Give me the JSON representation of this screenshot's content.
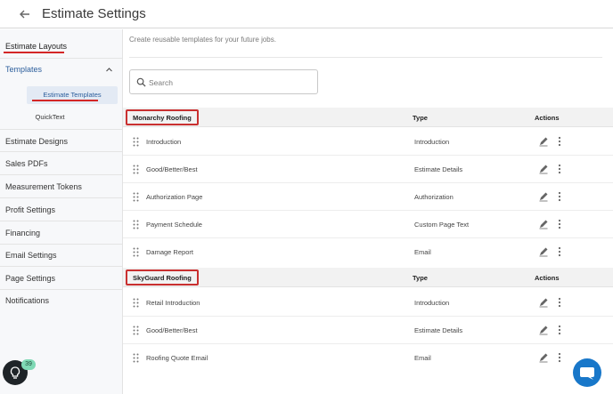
{
  "header": {
    "title": "Estimate Settings"
  },
  "sidebar": {
    "estimate_layouts": "Estimate Layouts",
    "templates": "Templates",
    "sub_estimate_templates": "Estimate Templates",
    "sub_quicktext": "QuickText",
    "items": [
      "Estimate Designs",
      "Sales PDFs",
      "Measurement Tokens",
      "Profit Settings",
      "Financing",
      "Email Settings",
      "Page Settings",
      "Notifications"
    ]
  },
  "main": {
    "intro": "Create reusable templates for your future jobs.",
    "search_placeholder": "Search",
    "col_type": "Type",
    "col_actions": "Actions",
    "groups": [
      {
        "name": "Monarchy Roofing",
        "rows": [
          {
            "name": "Introduction",
            "type": "Introduction"
          },
          {
            "name": "Good/Better/Best",
            "type": "Estimate Details"
          },
          {
            "name": "Authorization Page",
            "type": "Authorization"
          },
          {
            "name": "Payment Schedule",
            "type": "Custom Page Text"
          },
          {
            "name": "Damage Report",
            "type": "Email"
          }
        ]
      },
      {
        "name": "SkyGuard Roofing",
        "rows": [
          {
            "name": "Retail Introduction",
            "type": "Introduction"
          },
          {
            "name": "Good/Better/Best",
            "type": "Estimate Details"
          },
          {
            "name": "Roofing Quote Email",
            "type": "Email"
          }
        ]
      }
    ]
  },
  "badge_count": "39",
  "colors": {
    "accent_blue": "#1877c9",
    "highlight_red": "#c93030",
    "badge_green": "#7fd9b5"
  }
}
